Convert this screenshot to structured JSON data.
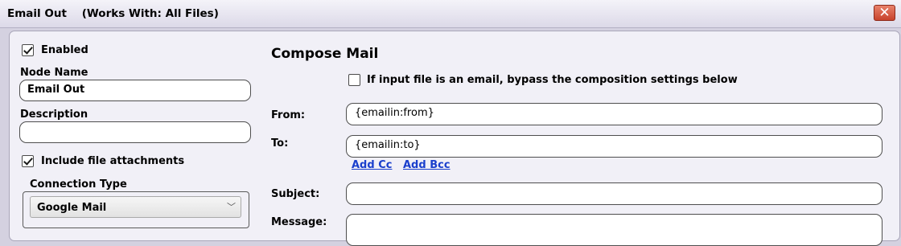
{
  "window": {
    "title": "Email Out",
    "works_with": "(Works With: All Files)",
    "close_glyph": "✕"
  },
  "left": {
    "enabled_label": "Enabled",
    "enabled_checked": true,
    "node_name_label": "Node Name",
    "node_name_value": "Email Out",
    "description_label": "Description",
    "description_value": "",
    "include_attachments_label": "Include file attachments",
    "include_attachments_checked": true,
    "connection_type_label": "Connection Type",
    "connection_type_value": "Google Mail"
  },
  "compose": {
    "title": "Compose Mail",
    "bypass_label": "If input file is an email, bypass the composition settings below",
    "bypass_checked": false,
    "from_label": "From:",
    "from_value": "{emailin:from}",
    "to_label": "To:",
    "to_value": "{emailin:to}",
    "add_cc": "Add Cc",
    "add_bcc": "Add Bcc",
    "subject_label": "Subject:",
    "subject_value": "",
    "message_label": "Message:",
    "message_value": ""
  },
  "colors": {
    "link": "#1a3fcc",
    "close_button": "#c8432c",
    "panel_background": "#f1f0f7"
  }
}
